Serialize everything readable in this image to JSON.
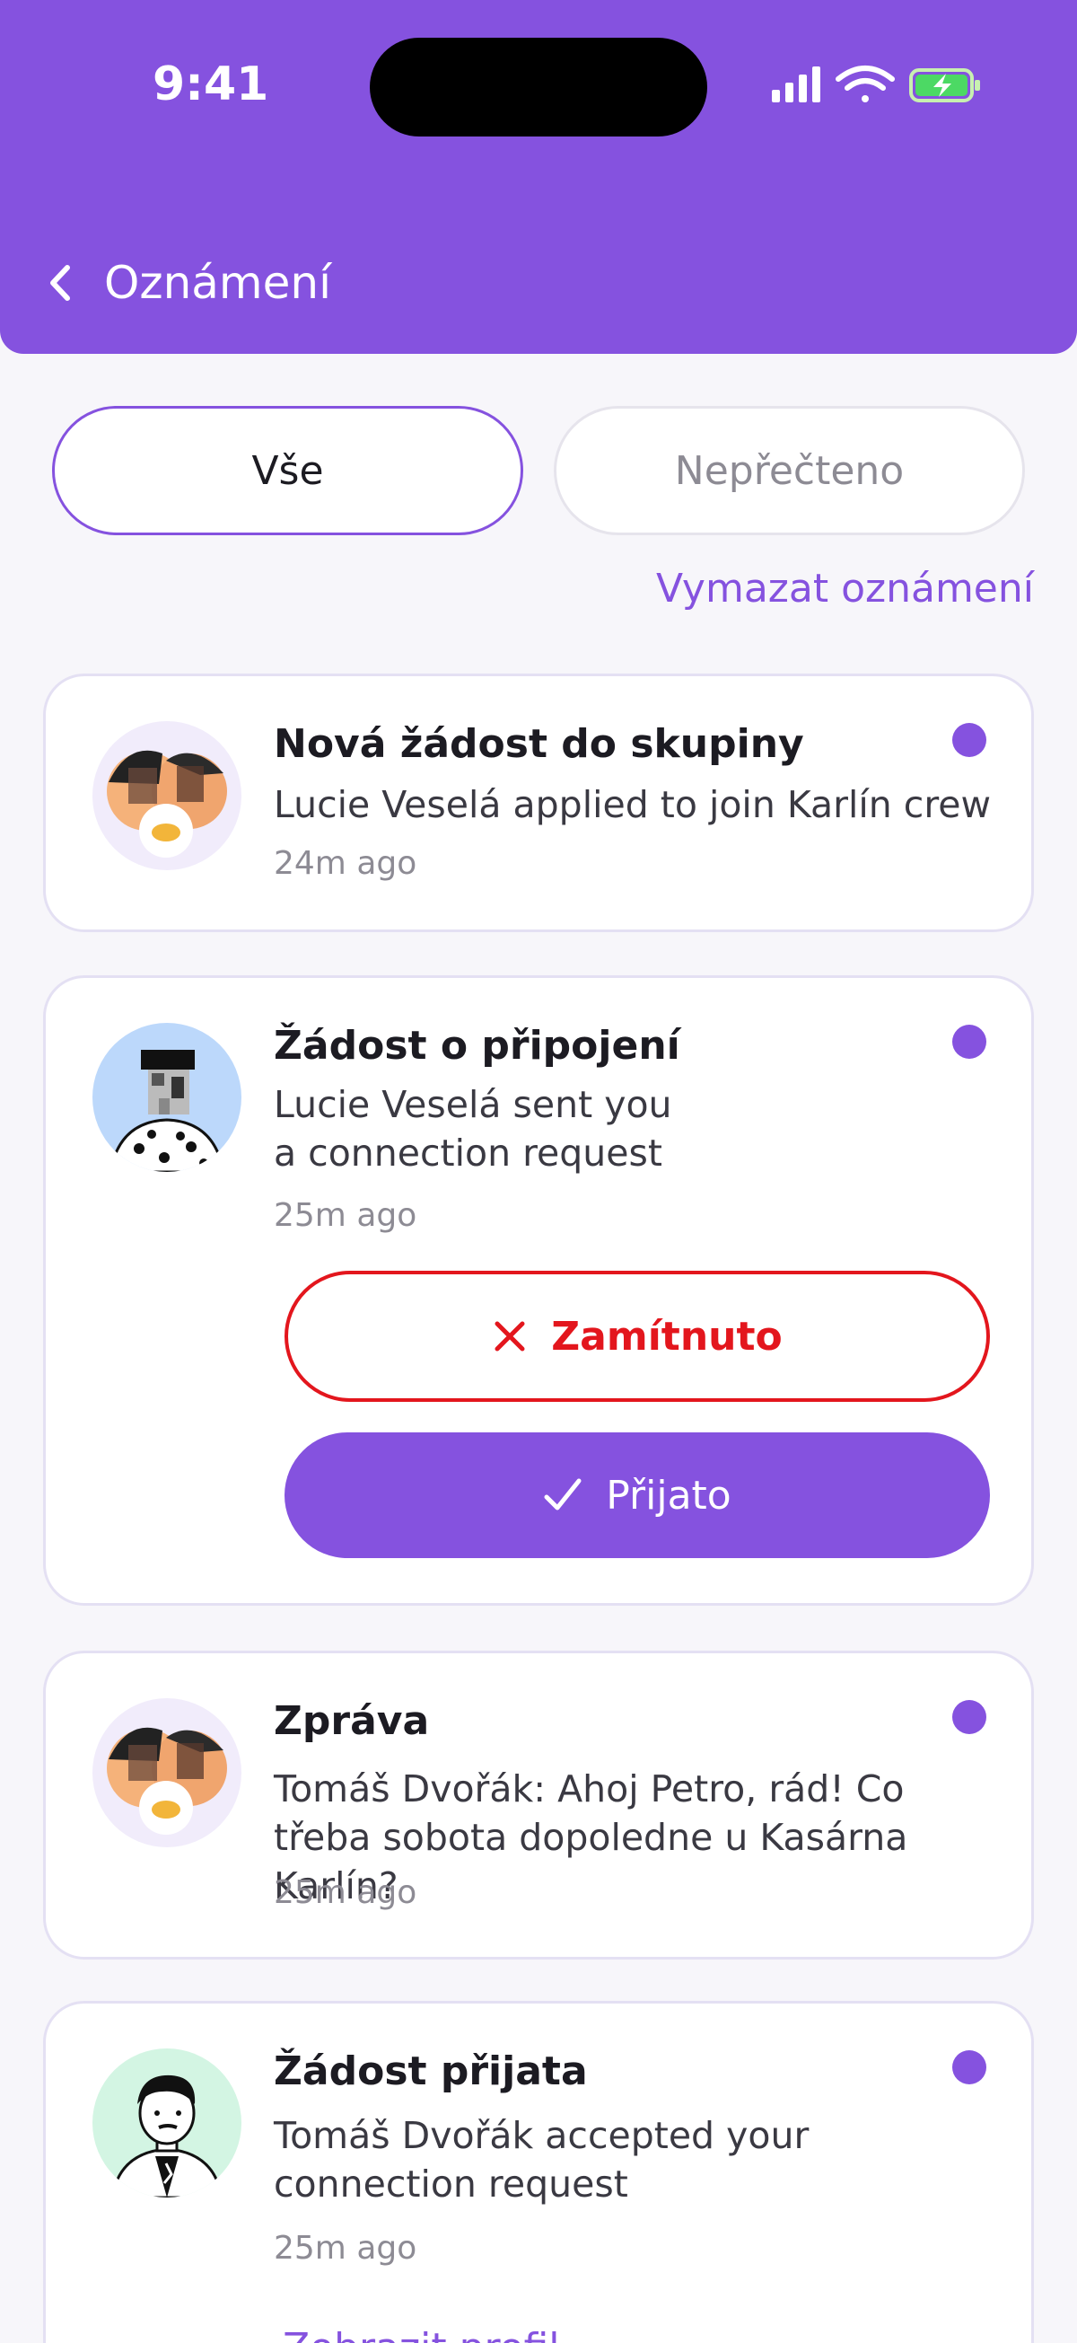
{
  "status_bar": {
    "time": "9:41"
  },
  "header": {
    "title": "Oznámení"
  },
  "tabs": [
    {
      "label": "Vše",
      "active": true
    },
    {
      "label": "Nepřečteno",
      "active": false
    }
  ],
  "clear_label": "Vymazat oznámení",
  "notifications": [
    {
      "title": "Nová žádost do skupiny",
      "body": "Lucie Veselá applied to join Karlín crew",
      "time": "24m ago",
      "unread": true,
      "avatar_icon": "group-avatar-icon"
    },
    {
      "title": "Žádost o připojení",
      "body": "Lucie Veselá sent you a connection request",
      "time": "25m ago",
      "unread": true,
      "avatar_icon": "user-avatar-icon",
      "reject_label": "Zamítnuto",
      "accept_label": "Přijato"
    },
    {
      "title": "Zpráva",
      "body": "Tomáš Dvořák: Ahoj Petro, rád! Co třeba sobota dopoledne u Kasárna Karlín?",
      "time": "25m ago",
      "unread": true,
      "avatar_icon": "group-avatar-icon"
    },
    {
      "title": "Žádost přijata",
      "body": "Tomáš Dvořák accepted your connection request",
      "time": "25m ago",
      "unread": true,
      "avatar_icon": "user-avatar-icon",
      "link_label": "Zobrazit profil"
    }
  ],
  "colors": {
    "accent": "#8552df",
    "reject": "#e3161d",
    "background": "#f7f6fa"
  }
}
